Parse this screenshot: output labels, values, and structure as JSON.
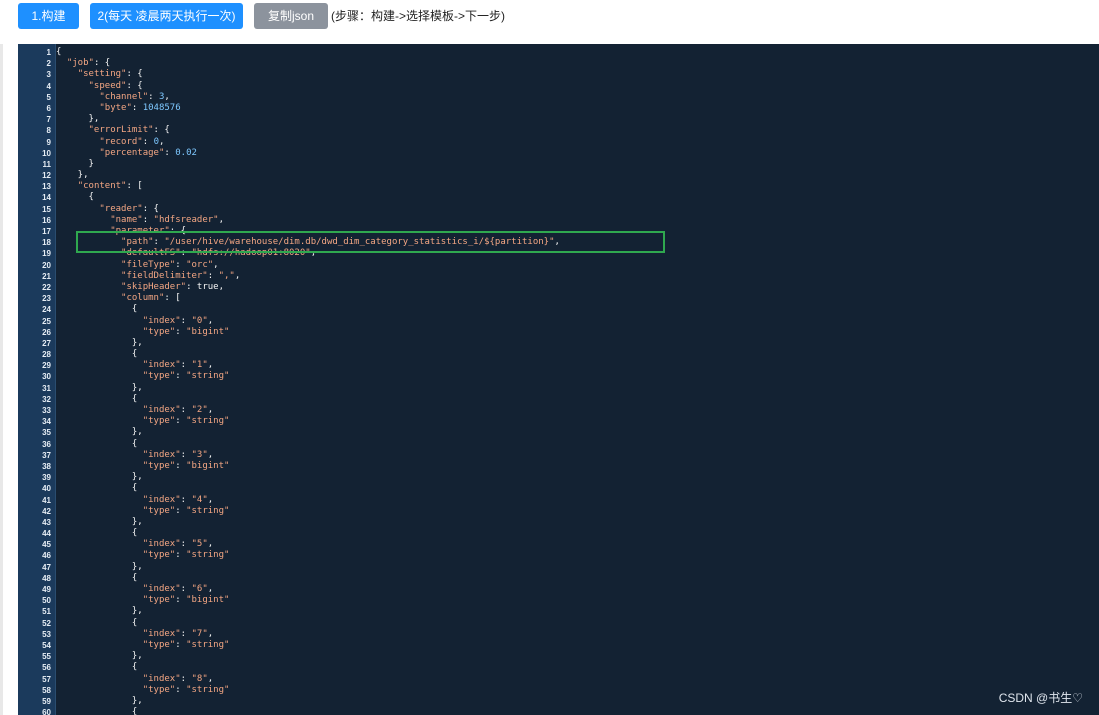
{
  "toolbar": {
    "build_label": "1.构建",
    "schedule_label": "2(每天 凌晨两天执行一次)",
    "copy_label": "复制json",
    "steps_hint": "(步骤：构建->选择模板->下一步)"
  },
  "editor": {
    "highlighted_line": 18,
    "lines": [
      [
        [
          "punc",
          "{"
        ]
      ],
      [
        [
          "punc",
          "  "
        ],
        [
          "key",
          "\"job\""
        ],
        [
          "punc",
          ": {"
        ]
      ],
      [
        [
          "punc",
          "    "
        ],
        [
          "key",
          "\"setting\""
        ],
        [
          "punc",
          ": {"
        ]
      ],
      [
        [
          "punc",
          "      "
        ],
        [
          "key",
          "\"speed\""
        ],
        [
          "punc",
          ": {"
        ]
      ],
      [
        [
          "punc",
          "        "
        ],
        [
          "key",
          "\"channel\""
        ],
        [
          "punc",
          ": "
        ],
        [
          "num",
          "3"
        ],
        [
          "punc",
          ","
        ]
      ],
      [
        [
          "punc",
          "        "
        ],
        [
          "key",
          "\"byte\""
        ],
        [
          "punc",
          ": "
        ],
        [
          "num",
          "1048576"
        ]
      ],
      [
        [
          "punc",
          "      },"
        ]
      ],
      [
        [
          "punc",
          "      "
        ],
        [
          "key",
          "\"errorLimit\""
        ],
        [
          "punc",
          ": {"
        ]
      ],
      [
        [
          "punc",
          "        "
        ],
        [
          "key",
          "\"record\""
        ],
        [
          "punc",
          ": "
        ],
        [
          "num",
          "0"
        ],
        [
          "punc",
          ","
        ]
      ],
      [
        [
          "punc",
          "        "
        ],
        [
          "key",
          "\"percentage\""
        ],
        [
          "punc",
          ": "
        ],
        [
          "num",
          "0.02"
        ]
      ],
      [
        [
          "punc",
          "      }"
        ]
      ],
      [
        [
          "punc",
          "    },"
        ]
      ],
      [
        [
          "punc",
          "    "
        ],
        [
          "key",
          "\"content\""
        ],
        [
          "punc",
          ": ["
        ]
      ],
      [
        [
          "punc",
          "      {"
        ]
      ],
      [
        [
          "punc",
          "        "
        ],
        [
          "key",
          "\"reader\""
        ],
        [
          "punc",
          ": {"
        ]
      ],
      [
        [
          "punc",
          "          "
        ],
        [
          "key",
          "\"name\""
        ],
        [
          "punc",
          ": "
        ],
        [
          "str",
          "\"hdfsreader\""
        ],
        [
          "punc",
          ","
        ]
      ],
      [
        [
          "punc",
          "          "
        ],
        [
          "key",
          "\"parameter\""
        ],
        [
          "punc",
          ": {"
        ]
      ],
      [
        [
          "punc",
          "            "
        ],
        [
          "key",
          "\"path\""
        ],
        [
          "punc",
          ": "
        ],
        [
          "str",
          "\"/user/hive/warehouse/dim.db/dwd_dim_category_statistics_i/${partition}\""
        ],
        [
          "punc",
          ","
        ]
      ],
      [
        [
          "punc",
          "            "
        ],
        [
          "key",
          "\"defaultFS\""
        ],
        [
          "punc",
          ": "
        ],
        [
          "str",
          "\"hdfs://hadoop01:8020\""
        ],
        [
          "punc",
          ","
        ]
      ],
      [
        [
          "punc",
          "            "
        ],
        [
          "key",
          "\"fileType\""
        ],
        [
          "punc",
          ": "
        ],
        [
          "str",
          "\"orc\""
        ],
        [
          "punc",
          ","
        ]
      ],
      [
        [
          "punc",
          "            "
        ],
        [
          "key",
          "\"fieldDelimiter\""
        ],
        [
          "punc",
          ": "
        ],
        [
          "str",
          "\",\""
        ],
        [
          "punc",
          ","
        ]
      ],
      [
        [
          "punc",
          "            "
        ],
        [
          "key",
          "\"skipHeader\""
        ],
        [
          "punc",
          ": "
        ],
        [
          "kw",
          "true"
        ],
        [
          "punc",
          ","
        ]
      ],
      [
        [
          "punc",
          "            "
        ],
        [
          "key",
          "\"column\""
        ],
        [
          "punc",
          ": ["
        ]
      ],
      [
        [
          "punc",
          "              {"
        ]
      ],
      [
        [
          "punc",
          "                "
        ],
        [
          "key",
          "\"index\""
        ],
        [
          "punc",
          ": "
        ],
        [
          "str",
          "\"0\""
        ],
        [
          "punc",
          ","
        ]
      ],
      [
        [
          "punc",
          "                "
        ],
        [
          "key",
          "\"type\""
        ],
        [
          "punc",
          ": "
        ],
        [
          "str",
          "\"bigint\""
        ]
      ],
      [
        [
          "punc",
          "              },"
        ]
      ],
      [
        [
          "punc",
          "              {"
        ]
      ],
      [
        [
          "punc",
          "                "
        ],
        [
          "key",
          "\"index\""
        ],
        [
          "punc",
          ": "
        ],
        [
          "str",
          "\"1\""
        ],
        [
          "punc",
          ","
        ]
      ],
      [
        [
          "punc",
          "                "
        ],
        [
          "key",
          "\"type\""
        ],
        [
          "punc",
          ": "
        ],
        [
          "str",
          "\"string\""
        ]
      ],
      [
        [
          "punc",
          "              },"
        ]
      ],
      [
        [
          "punc",
          "              {"
        ]
      ],
      [
        [
          "punc",
          "                "
        ],
        [
          "key",
          "\"index\""
        ],
        [
          "punc",
          ": "
        ],
        [
          "str",
          "\"2\""
        ],
        [
          "punc",
          ","
        ]
      ],
      [
        [
          "punc",
          "                "
        ],
        [
          "key",
          "\"type\""
        ],
        [
          "punc",
          ": "
        ],
        [
          "str",
          "\"string\""
        ]
      ],
      [
        [
          "punc",
          "              },"
        ]
      ],
      [
        [
          "punc",
          "              {"
        ]
      ],
      [
        [
          "punc",
          "                "
        ],
        [
          "key",
          "\"index\""
        ],
        [
          "punc",
          ": "
        ],
        [
          "str",
          "\"3\""
        ],
        [
          "punc",
          ","
        ]
      ],
      [
        [
          "punc",
          "                "
        ],
        [
          "key",
          "\"type\""
        ],
        [
          "punc",
          ": "
        ],
        [
          "str",
          "\"bigint\""
        ]
      ],
      [
        [
          "punc",
          "              },"
        ]
      ],
      [
        [
          "punc",
          "              {"
        ]
      ],
      [
        [
          "punc",
          "                "
        ],
        [
          "key",
          "\"index\""
        ],
        [
          "punc",
          ": "
        ],
        [
          "str",
          "\"4\""
        ],
        [
          "punc",
          ","
        ]
      ],
      [
        [
          "punc",
          "                "
        ],
        [
          "key",
          "\"type\""
        ],
        [
          "punc",
          ": "
        ],
        [
          "str",
          "\"string\""
        ]
      ],
      [
        [
          "punc",
          "              },"
        ]
      ],
      [
        [
          "punc",
          "              {"
        ]
      ],
      [
        [
          "punc",
          "                "
        ],
        [
          "key",
          "\"index\""
        ],
        [
          "punc",
          ": "
        ],
        [
          "str",
          "\"5\""
        ],
        [
          "punc",
          ","
        ]
      ],
      [
        [
          "punc",
          "                "
        ],
        [
          "key",
          "\"type\""
        ],
        [
          "punc",
          ": "
        ],
        [
          "str",
          "\"string\""
        ]
      ],
      [
        [
          "punc",
          "              },"
        ]
      ],
      [
        [
          "punc",
          "              {"
        ]
      ],
      [
        [
          "punc",
          "                "
        ],
        [
          "key",
          "\"index\""
        ],
        [
          "punc",
          ": "
        ],
        [
          "str",
          "\"6\""
        ],
        [
          "punc",
          ","
        ]
      ],
      [
        [
          "punc",
          "                "
        ],
        [
          "key",
          "\"type\""
        ],
        [
          "punc",
          ": "
        ],
        [
          "str",
          "\"bigint\""
        ]
      ],
      [
        [
          "punc",
          "              },"
        ]
      ],
      [
        [
          "punc",
          "              {"
        ]
      ],
      [
        [
          "punc",
          "                "
        ],
        [
          "key",
          "\"index\""
        ],
        [
          "punc",
          ": "
        ],
        [
          "str",
          "\"7\""
        ],
        [
          "punc",
          ","
        ]
      ],
      [
        [
          "punc",
          "                "
        ],
        [
          "key",
          "\"type\""
        ],
        [
          "punc",
          ": "
        ],
        [
          "str",
          "\"string\""
        ]
      ],
      [
        [
          "punc",
          "              },"
        ]
      ],
      [
        [
          "punc",
          "              {"
        ]
      ],
      [
        [
          "punc",
          "                "
        ],
        [
          "key",
          "\"index\""
        ],
        [
          "punc",
          ": "
        ],
        [
          "str",
          "\"8\""
        ],
        [
          "punc",
          ","
        ]
      ],
      [
        [
          "punc",
          "                "
        ],
        [
          "key",
          "\"type\""
        ],
        [
          "punc",
          ": "
        ],
        [
          "str",
          "\"string\""
        ]
      ],
      [
        [
          "punc",
          "              },"
        ]
      ],
      [
        [
          "punc",
          "              {"
        ]
      ]
    ]
  },
  "watermark": "CSDN @书生♡"
}
